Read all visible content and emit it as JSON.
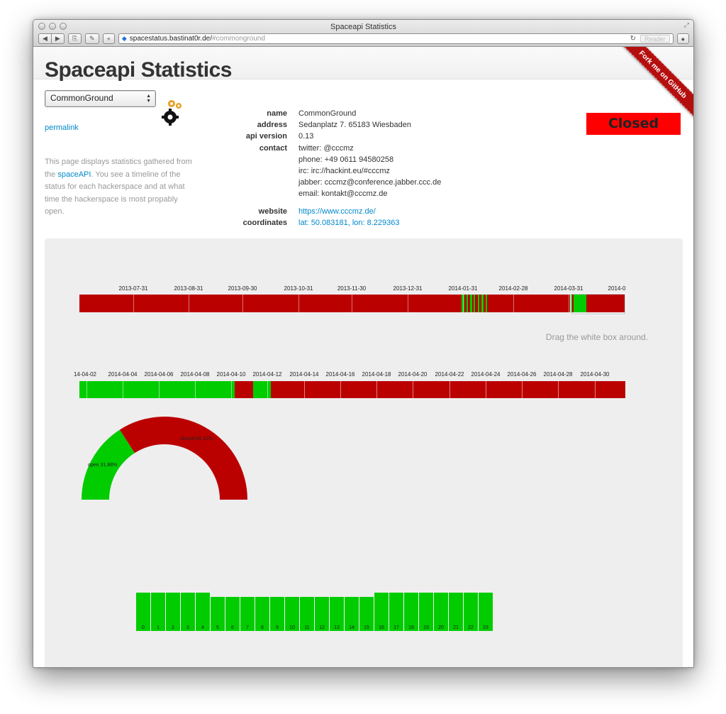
{
  "window": {
    "title": "Spaceapi Statistics",
    "url_host": "spacestatus.bastinat0r.de/",
    "url_fragment": "#commonground",
    "reader_label": "Reader"
  },
  "page": {
    "title": "Spaceapi Statistics",
    "ribbon": "Fork me on GitHub",
    "space_select": "CommonGround",
    "permalink": "permalink",
    "description": {
      "part1": "This page displays statistics gathered from the ",
      "link": "spaceAPI",
      "part2": ". You see a timeline of the status for each hackerspace and at what time the hackerspace is most propably open."
    },
    "status": "Closed"
  },
  "info": {
    "name_label": "name",
    "name": "CommonGround",
    "address_label": "address",
    "address": "Sedanplatz 7. 65183 Wiesbaden",
    "api_label": "api version",
    "api": "0.13",
    "contact_label": "contact",
    "twitter": "twitter: @cccmz",
    "phone": "phone: +49 0611 94580258",
    "irc": "irc: irc://hackint.eu/#cccmz",
    "jabber": "jabber: cccmz@conference.jabber.ccc.de",
    "email": "email: kontakt@cccmz.de",
    "website_label": "website",
    "website": "https://www.cccmz.de/",
    "coords_label": "coordinates",
    "coords": "lat: 50.083181, lon: 8.229363"
  },
  "overview": {
    "labels": [
      "2013-07-31",
      "2013-08-31",
      "2013-09-30",
      "2013-10-31",
      "2013-11-30",
      "2013-12-31",
      "2014-01-31",
      "2014-02-28",
      "2014-03-31",
      "2014-0"
    ],
    "hint": "Drag the white box around."
  },
  "detail": {
    "labels": [
      "14-04-02",
      "2014-04-04",
      "2014-04-06",
      "2014-04-08",
      "2014-04-10",
      "2014-04-12",
      "2014-04-14",
      "2014-04-16",
      "2014-04-18",
      "2014-04-20",
      "2014-04-22",
      "2014-04-24",
      "2014-04-26",
      "2014-04-28",
      "2014-04-30"
    ]
  },
  "donut": {
    "open_label": "open 31.88%",
    "closed_label": "closed 68.12%",
    "open_fraction": 0.3188,
    "closed_fraction": 0.6812
  },
  "hourly": {
    "hours": [
      "0",
      "1",
      "2",
      "3",
      "4",
      "5",
      "6",
      "7",
      "8",
      "9",
      "10",
      "11",
      "12",
      "13",
      "14",
      "15",
      "16",
      "17",
      "18",
      "19",
      "20",
      "21",
      "22",
      "23"
    ]
  },
  "colors": {
    "open": "#00cc00",
    "closed": "#bb0000",
    "status_badge": "#ff0000",
    "link": "#0088cc"
  }
}
